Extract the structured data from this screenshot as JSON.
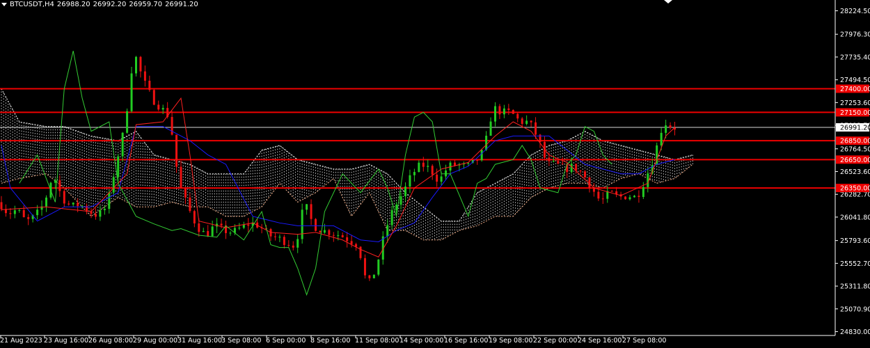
{
  "header": {
    "symbol": "BTCUSDT,H4",
    "open": "26988.20",
    "high": "26992.20",
    "low": "26959.70",
    "close": "26991.20"
  },
  "colors": {
    "background": "#000000",
    "axis": "#ffffff",
    "bull": "#22cc22",
    "bear": "#ee1111",
    "hline": "#ee0000",
    "tenkan": "#ff2020",
    "kijun": "#1a1aff",
    "chikou": "#33cc33",
    "cloud_bear": "#f0f0f0",
    "cloud_bull": "#f5b08a",
    "current": "#ffffff"
  },
  "chart_data": {
    "type": "candlestick",
    "symbol": "BTCUSDT",
    "timeframe": "H4",
    "y_ticks": [
      "28224.50",
      "27976.30",
      "27735.40",
      "27494.50",
      "27253.60",
      "27012.70",
      "26764.50",
      "26523.60",
      "26282.70",
      "26041.80",
      "25793.60",
      "25552.70",
      "25311.80",
      "25070.90",
      "24830.00"
    ],
    "ylim": [
      24830.0,
      28224.5
    ],
    "x_ticks": [
      "21 Aug 2023",
      "23 Aug 16:00",
      "26 Aug 08:00",
      "29 Aug 00:00",
      "31 Aug 16:00",
      "3 Sep 08:00",
      "6 Sep 00:00",
      "8 Sep 16:00",
      "11 Sep 08:00",
      "14 Sep 00:00",
      "16 Sep 16:00",
      "19 Sep 08:00",
      "22 Sep 00:00",
      "24 Sep 16:00",
      "27 Sep 08:00"
    ],
    "levels": [
      {
        "label": "27400.00",
        "value": 27400.0
      },
      {
        "label": "27150.00",
        "value": 27150.0
      },
      {
        "label": "26850.00",
        "value": 26850.0
      },
      {
        "label": "26650.00",
        "value": 26650.0
      },
      {
        "label": "26350.00",
        "value": 26350.0
      }
    ],
    "current_price": {
      "label": "26991.20",
      "value": 26991.2
    },
    "price_path": [
      [
        0,
        26200
      ],
      [
        2,
        26080
      ],
      [
        4,
        26120
      ],
      [
        6,
        25990
      ],
      [
        8,
        26050
      ],
      [
        10,
        26180
      ],
      [
        12,
        26500
      ],
      [
        14,
        26250
      ],
      [
        16,
        26150
      ],
      [
        18,
        26180
      ],
      [
        20,
        26100
      ],
      [
        22,
        26060
      ],
      [
        24,
        26150
      ],
      [
        26,
        26600
      ],
      [
        28,
        27000
      ],
      [
        30,
        27800
      ],
      [
        32,
        27500
      ],
      [
        34,
        27300
      ],
      [
        36,
        27200
      ],
      [
        38,
        27100
      ],
      [
        40,
        26400
      ],
      [
        42,
        26150
      ],
      [
        44,
        25950
      ],
      [
        46,
        25850
      ],
      [
        48,
        25950
      ],
      [
        50,
        25900
      ],
      [
        52,
        25880
      ],
      [
        54,
        25930
      ],
      [
        56,
        25980
      ],
      [
        58,
        25950
      ],
      [
        60,
        25850
      ],
      [
        62,
        25820
      ],
      [
        64,
        25780
      ],
      [
        66,
        25730
      ],
      [
        68,
        26200
      ],
      [
        70,
        25950
      ],
      [
        72,
        25900
      ],
      [
        74,
        25880
      ],
      [
        76,
        25850
      ],
      [
        78,
        25800
      ],
      [
        80,
        25750
      ],
      [
        82,
        25300
      ],
      [
        84,
        25500
      ],
      [
        86,
        25900
      ],
      [
        88,
        26150
      ],
      [
        90,
        26300
      ],
      [
        92,
        26500
      ],
      [
        94,
        26600
      ],
      [
        96,
        26550
      ],
      [
        98,
        26420
      ],
      [
        100,
        26580
      ],
      [
        102,
        26600
      ],
      [
        104,
        26570
      ],
      [
        106,
        26620
      ],
      [
        108,
        26750
      ],
      [
        110,
        27200
      ],
      [
        112,
        27150
      ],
      [
        114,
        27150
      ],
      [
        116,
        27050
      ],
      [
        118,
        27050
      ],
      [
        120,
        26880
      ],
      [
        122,
        26600
      ],
      [
        124,
        26600
      ],
      [
        126,
        26550
      ],
      [
        128,
        26580
      ],
      [
        130,
        26500
      ],
      [
        132,
        26350
      ],
      [
        134,
        26200
      ],
      [
        136,
        26300
      ],
      [
        138,
        26250
      ],
      [
        140,
        26270
      ],
      [
        142,
        26250
      ],
      [
        144,
        26450
      ],
      [
        146,
        26700
      ],
      [
        148,
        27050
      ],
      [
        150,
        26990
      ]
    ],
    "tenkan_sen": [
      [
        0,
        26120
      ],
      [
        10,
        26150
      ],
      [
        20,
        26100
      ],
      [
        28,
        26500
      ],
      [
        30,
        27020
      ],
      [
        36,
        27050
      ],
      [
        40,
        27300
      ],
      [
        42,
        26700
      ],
      [
        44,
        26000
      ],
      [
        50,
        25930
      ],
      [
        56,
        25980
      ],
      [
        60,
        25880
      ],
      [
        66,
        25860
      ],
      [
        70,
        25880
      ],
      [
        76,
        25800
      ],
      [
        80,
        25700
      ],
      [
        84,
        25620
      ],
      [
        88,
        25950
      ],
      [
        92,
        26350
      ],
      [
        98,
        26550
      ],
      [
        104,
        26620
      ],
      [
        110,
        26900
      ],
      [
        114,
        27050
      ],
      [
        118,
        26950
      ],
      [
        122,
        26700
      ],
      [
        126,
        26620
      ],
      [
        132,
        26350
      ],
      [
        138,
        26270
      ],
      [
        144,
        26400
      ],
      [
        148,
        26900
      ],
      [
        150,
        26990
      ]
    ],
    "kijun_sen": [
      [
        0,
        26800
      ],
      [
        2,
        26350
      ],
      [
        8,
        26000
      ],
      [
        14,
        26150
      ],
      [
        20,
        26150
      ],
      [
        26,
        26300
      ],
      [
        30,
        27000
      ],
      [
        36,
        27000
      ],
      [
        42,
        26850
      ],
      [
        46,
        26700
      ],
      [
        50,
        26600
      ],
      [
        56,
        26050
      ],
      [
        62,
        25980
      ],
      [
        66,
        25950
      ],
      [
        70,
        25950
      ],
      [
        74,
        25950
      ],
      [
        80,
        25800
      ],
      [
        84,
        25780
      ],
      [
        88,
        25900
      ],
      [
        92,
        25980
      ],
      [
        96,
        26250
      ],
      [
        100,
        26500
      ],
      [
        104,
        26580
      ],
      [
        110,
        26850
      ],
      [
        114,
        26900
      ],
      [
        118,
        26900
      ],
      [
        122,
        26900
      ],
      [
        126,
        26750
      ],
      [
        130,
        26600
      ],
      [
        134,
        26550
      ],
      [
        138,
        26500
      ],
      [
        142,
        26500
      ],
      [
        146,
        26600
      ],
      [
        150,
        26650
      ]
    ],
    "chikou_span": [
      [
        4,
        26400
      ],
      [
        8,
        26700
      ],
      [
        12,
        26200
      ],
      [
        14,
        27400
      ],
      [
        16,
        27800
      ],
      [
        18,
        27300
      ],
      [
        20,
        26950
      ],
      [
        24,
        27050
      ],
      [
        26,
        26400
      ],
      [
        30,
        26050
      ],
      [
        34,
        25970
      ],
      [
        38,
        25900
      ],
      [
        40,
        25920
      ],
      [
        44,
        25850
      ],
      [
        48,
        25830
      ],
      [
        50,
        25950
      ],
      [
        54,
        25800
      ],
      [
        58,
        26100
      ],
      [
        60,
        25750
      ],
      [
        62,
        25720
      ],
      [
        64,
        25720
      ],
      [
        66,
        25500
      ],
      [
        68,
        25220
      ],
      [
        70,
        25500
      ],
      [
        72,
        26100
      ],
      [
        76,
        26500
      ],
      [
        80,
        26300
      ],
      [
        84,
        26550
      ],
      [
        86,
        26350
      ],
      [
        88,
        26050
      ],
      [
        90,
        26700
      ],
      [
        92,
        27100
      ],
      [
        94,
        27150
      ],
      [
        96,
        27050
      ],
      [
        98,
        26500
      ],
      [
        100,
        26500
      ],
      [
        104,
        26050
      ],
      [
        106,
        26400
      ],
      [
        108,
        26450
      ],
      [
        110,
        26600
      ],
      [
        114,
        26650
      ],
      [
        116,
        26800
      ],
      [
        118,
        26650
      ],
      [
        120,
        26350
      ],
      [
        124,
        26300
      ],
      [
        126,
        26600
      ],
      [
        128,
        26700
      ],
      [
        130,
        27000
      ],
      [
        132,
        26950
      ],
      [
        134,
        26700
      ],
      [
        136,
        26600
      ]
    ],
    "cloud": [
      [
        0,
        27400,
        26400
      ],
      [
        4,
        27050,
        26450
      ],
      [
        10,
        27000,
        26500
      ],
      [
        14,
        27000,
        26350
      ],
      [
        20,
        26900,
        26050
      ],
      [
        26,
        26850,
        26250
      ],
      [
        30,
        26950,
        26150
      ],
      [
        34,
        26700,
        26150
      ],
      [
        38,
        26650,
        26200
      ],
      [
        42,
        26600,
        26150
      ],
      [
        46,
        26500,
        26150
      ],
      [
        50,
        26500,
        26050
      ],
      [
        54,
        26500,
        26050
      ],
      [
        58,
        26750,
        26150
      ],
      [
        62,
        26800,
        26400
      ],
      [
        66,
        26650,
        26200
      ],
      [
        70,
        26600,
        26300
      ],
      [
        74,
        26550,
        26450
      ],
      [
        78,
        26550,
        26050
      ],
      [
        82,
        26600,
        26300
      ],
      [
        86,
        26500,
        25900
      ],
      [
        90,
        26300,
        25900
      ],
      [
        94,
        26150,
        25800
      ],
      [
        98,
        26000,
        25800
      ],
      [
        102,
        26000,
        25900
      ],
      [
        106,
        26300,
        25950
      ],
      [
        110,
        26400,
        26050
      ],
      [
        114,
        26500,
        26050
      ],
      [
        118,
        26700,
        26250
      ],
      [
        122,
        26800,
        26350
      ],
      [
        126,
        26850,
        26400
      ],
      [
        130,
        26950,
        26400
      ],
      [
        134,
        26850,
        26350
      ],
      [
        138,
        26800,
        26450
      ],
      [
        142,
        26750,
        26500
      ],
      [
        146,
        26700,
        26400
      ],
      [
        150,
        26650,
        26450
      ],
      [
        154,
        26700,
        26600
      ]
    ]
  }
}
